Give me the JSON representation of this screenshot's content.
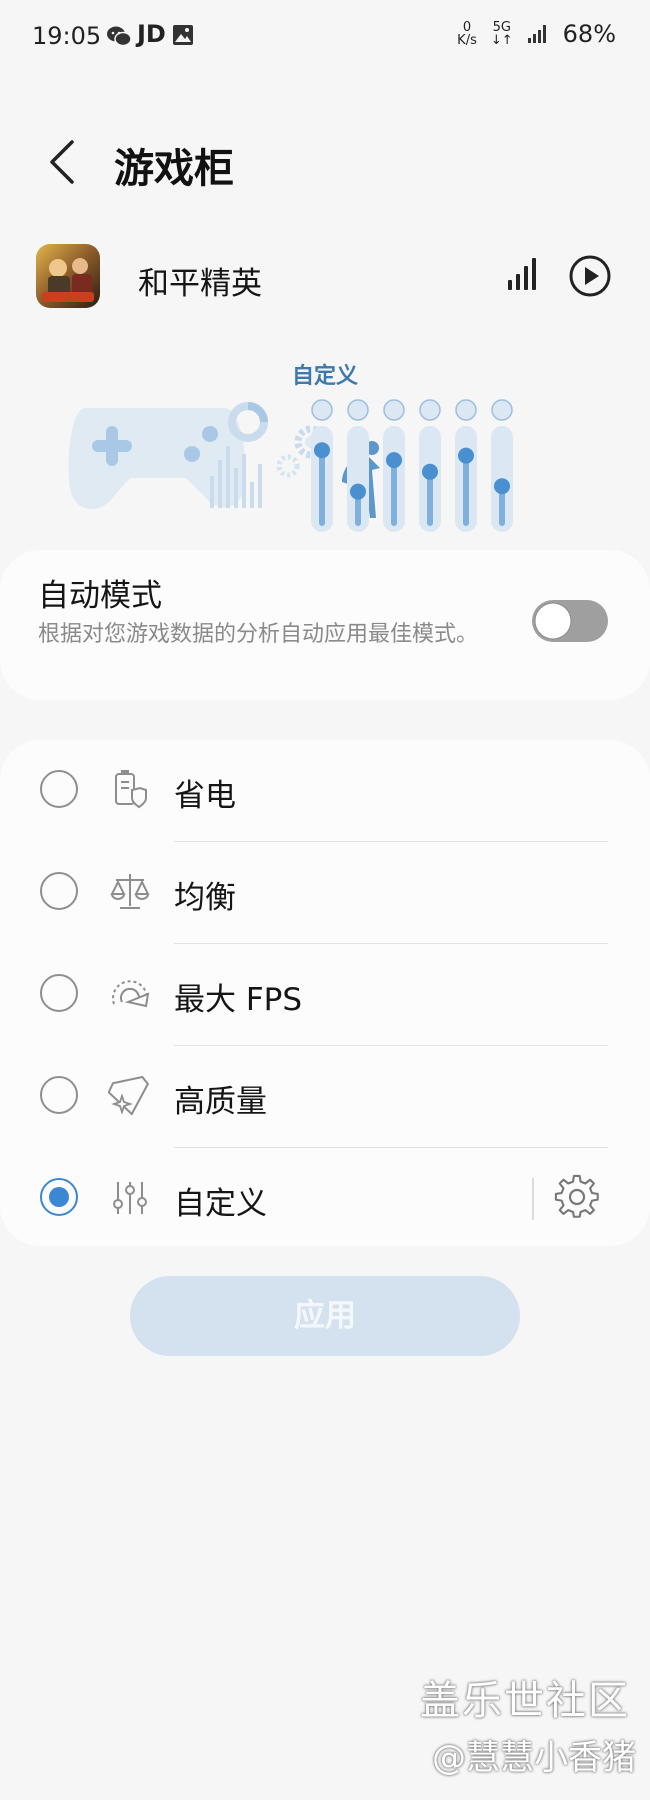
{
  "status_bar": {
    "time": "19:05",
    "left_icons": [
      "wechat-icon",
      "jd-icon",
      "gallery-icon"
    ],
    "jd_label": "JD",
    "net_speed_value": "0",
    "net_speed_unit": "K/s",
    "network_type": "5G",
    "battery": "68%"
  },
  "header": {
    "title": "游戏柜",
    "back_icon": "chevron-left-icon"
  },
  "game": {
    "name": "和平精英",
    "performance_icon": "signal-bars-icon",
    "play_icon": "play-circle-icon"
  },
  "illustration": {
    "current_mode": "自定义",
    "slider_levels": [
      0.82,
      0.36,
      0.71,
      0.58,
      0.76,
      0.42
    ],
    "slider_icons": [
      "battery-icon",
      "thermometer-icon",
      "display-icon",
      "cpu-icon",
      "memory-icon",
      "trend-icon"
    ],
    "accent_color": "#3f79ac"
  },
  "auto_mode": {
    "title": "自动模式",
    "description": "根据对您游戏数据的分析自动应用最佳模式。",
    "enabled": false
  },
  "modes": [
    {
      "label": "省电",
      "icon": "battery-shield-icon",
      "selected": false
    },
    {
      "label": "均衡",
      "icon": "scale-balance-icon",
      "selected": false
    },
    {
      "label": "最大 FPS",
      "icon": "speedometer-icon",
      "selected": false
    },
    {
      "label": "高质量",
      "icon": "gem-sparkle-icon",
      "selected": false
    },
    {
      "label": "自定义",
      "icon": "sliders-icon",
      "selected": true,
      "settings_icon": "gear-icon"
    }
  ],
  "apply_button": {
    "label": "应用",
    "enabled": false
  },
  "watermark": {
    "line1": "盖乐世社区",
    "line2": "@慧慧小香猪"
  },
  "colors": {
    "radio_selected": "#3b87d3",
    "apply_disabled_bg": "#d4e1ee",
    "background": "#f6f6f6",
    "card": "#fcfcfc"
  }
}
